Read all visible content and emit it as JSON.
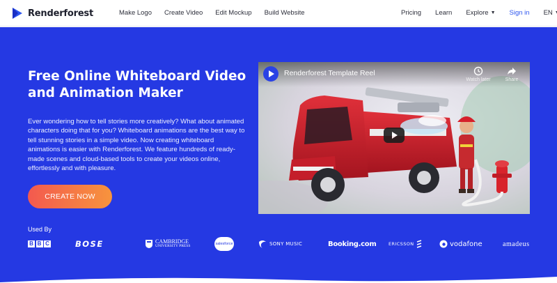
{
  "brand": {
    "name": "Renderforest"
  },
  "nav": {
    "left": [
      "Make Logo",
      "Create Video",
      "Edit Mockup",
      "Build Website"
    ],
    "pricing": "Pricing",
    "learn": "Learn",
    "explore": "Explore",
    "signin": "Sign in",
    "lang": "EN"
  },
  "hero": {
    "title": "Free Online Whiteboard Video and Animation Maker",
    "description": "Ever wondering how to tell stories more creatively? What about animated characters doing that for you? Whiteboard animations are the best way to tell stunning stories in a simple video. Now creating whiteboard animations is easier with Renderforest. We feature hundreds of ready-made scenes and cloud-based tools to create your videos online, effortlessly and with pleasure.",
    "cta": "CREATE NOW"
  },
  "video": {
    "title": "Renderforest Template Reel",
    "watch_later": "Watch later",
    "share": "Share"
  },
  "used_by": {
    "label": "Used By",
    "bbc_letters": [
      "B",
      "B",
      "C"
    ],
    "bose": "BOSE",
    "cambridge_1": "CAMBRIDGE",
    "cambridge_2": "UNIVERSITY PRESS",
    "salesforce": "salesforce",
    "sony": "SONY MUSIC",
    "booking": "Booking.com",
    "ericsson": "ERICSSON",
    "vodafone": "vodafone",
    "amadeus": "amadeus"
  },
  "colors": {
    "brand_blue": "#2539e3",
    "link_blue": "#2c55ef",
    "cta_from": "#f3594f",
    "cta_to": "#f7943d"
  },
  "icons": [
    "renderforest-logo",
    "chevron-down-icon",
    "clock-icon",
    "share-icon",
    "play-icon"
  ]
}
